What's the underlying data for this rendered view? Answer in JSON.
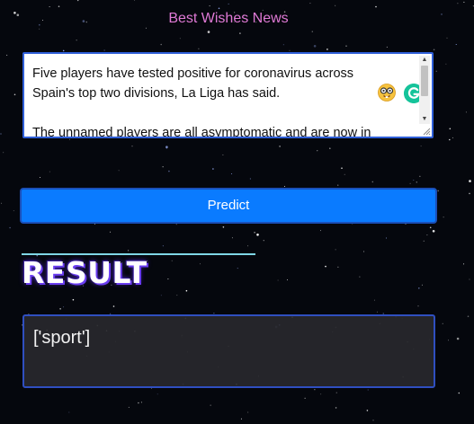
{
  "header": {
    "title": "Best Wishes News"
  },
  "news_input": {
    "paragraphs": [
      "Five players have tested positive for coronavirus across Spain's top two divisions, La Liga has said.",
      "The unnamed players are all asymptomatic and are now in"
    ]
  },
  "toolbar": {
    "predict_label": "Predict"
  },
  "result": {
    "heading": "RESULT",
    "value": "['sport']"
  },
  "colors": {
    "background": "#05070d",
    "title": "#e07ad6",
    "button": "#0a7bff",
    "input_border": "#2f5fd8"
  },
  "icons": [
    "nerd-face-emoji-icon",
    "grammarly-icon",
    "scroll-up-arrow-icon",
    "scroll-down-arrow-icon",
    "resize-grip-icon"
  ]
}
